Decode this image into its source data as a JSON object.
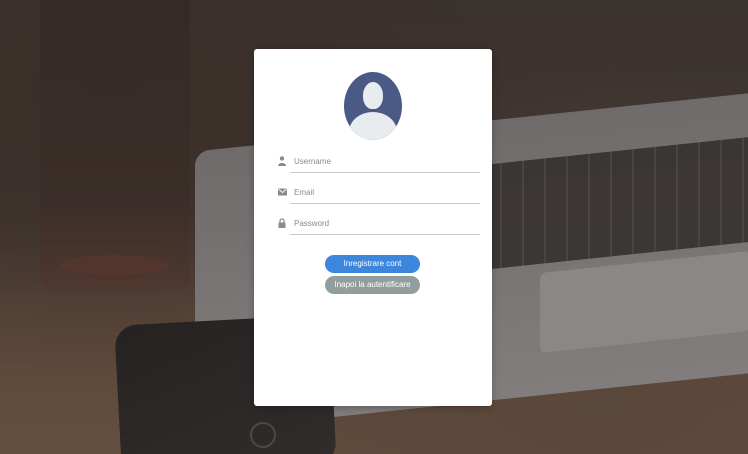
{
  "form": {
    "username": {
      "placeholder": "Username",
      "value": "",
      "icon": "user-icon"
    },
    "email": {
      "placeholder": "Email",
      "value": "",
      "icon": "envelope-icon"
    },
    "password": {
      "placeholder": "Password",
      "value": "",
      "icon": "lock-icon"
    }
  },
  "buttons": {
    "register_label": "Inregistrare cont",
    "back_label": "Inapoi la autentificare"
  },
  "colors": {
    "primary_button": "#3c86dc",
    "secondary_button": "#929e9e",
    "avatar_bg": "#4a5a85"
  }
}
